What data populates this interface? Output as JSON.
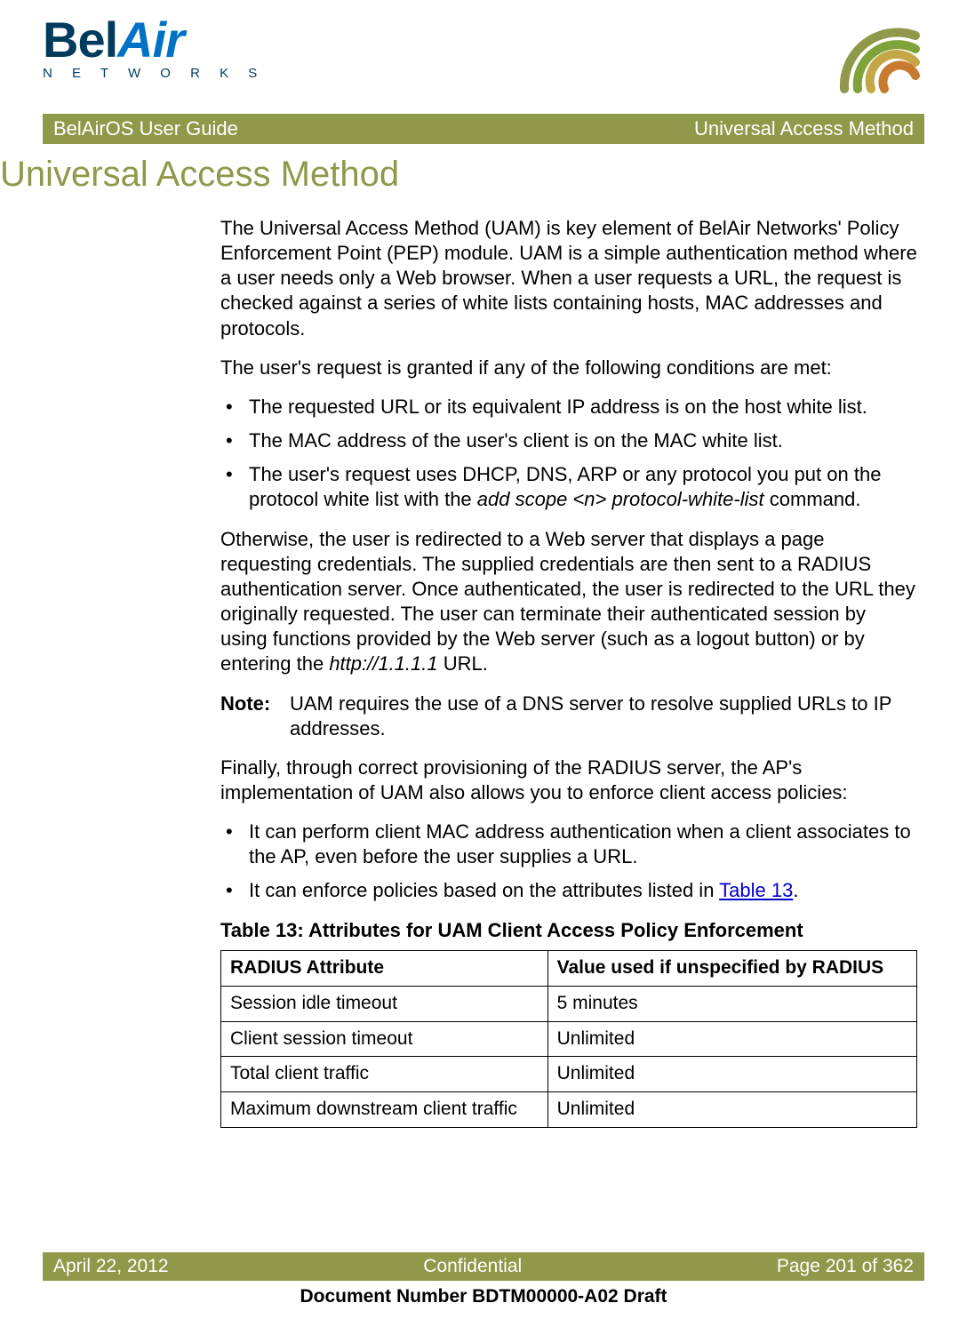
{
  "logo": {
    "part1": "Bel",
    "part2": "Air",
    "sub": "N E T W O R K S"
  },
  "header": {
    "left": "BelAirOS User Guide",
    "right": "Universal Access Method"
  },
  "title": "Universal Access Method",
  "p1": "The Universal Access Method (UAM) is key element of BelAir Networks' Policy Enforcement Point (PEP) module. UAM is a simple authentication method where a user needs only a Web browser. When a user requests a URL, the request is checked against a series of white lists containing hosts, MAC addresses and protocols.",
  "p2": "The user's request is granted if any of the following conditions are met:",
  "bullets1": [
    "The requested URL or its equivalent IP address is on the host white list.",
    "The MAC address of the user's client is on the MAC white list."
  ],
  "bullet1_3_a": "The user's request uses DHCP, DNS, ARP or any protocol you put on the protocol white list with the ",
  "bullet1_3_cmd": "add scope <n> protocol-white-list",
  "bullet1_3_b": " command.",
  "p3_a": "Otherwise, the user is redirected to a Web server that displays a page requesting credentials. The supplied credentials are then sent to a RADIUS authentication server. Once authenticated, the user is redirected to the URL they originally requested. The user can terminate their authenticated session by using functions provided by the Web server (such as a logout button) or by entering the ",
  "p3_url": "http://1.1.1.1",
  "p3_b": " URL.",
  "note_label": "Note:",
  "note_text": "UAM requires the use of a DNS server to resolve supplied URLs to IP addresses.",
  "p4": "Finally, through correct provisioning of the RADIUS server, the AP's implementation of UAM also allows you to enforce client access policies:",
  "bullets2_0": "It can perform client MAC address authentication when a client associates to the AP, even before the user supplies a URL.",
  "bullets2_1_a": "It can enforce policies based on the attributes listed in ",
  "bullets2_1_link": "Table 13",
  "bullets2_1_b": ".",
  "table": {
    "caption": "Table 13: Attributes for UAM Client Access Policy Enforcement",
    "headers": [
      "RADIUS Attribute",
      "Value used if unspecified by RADIUS"
    ],
    "rows": [
      [
        "Session idle timeout",
        "5 minutes"
      ],
      [
        "Client session timeout",
        "Unlimited"
      ],
      [
        "Total client traffic",
        "Unlimited"
      ],
      [
        "Maximum downstream client traffic",
        "Unlimited"
      ]
    ]
  },
  "footer": {
    "left": "April 22, 2012",
    "center": "Confidential",
    "right": "Page 201 of 362",
    "docnum": "Document Number BDTM00000-A02 Draft"
  }
}
